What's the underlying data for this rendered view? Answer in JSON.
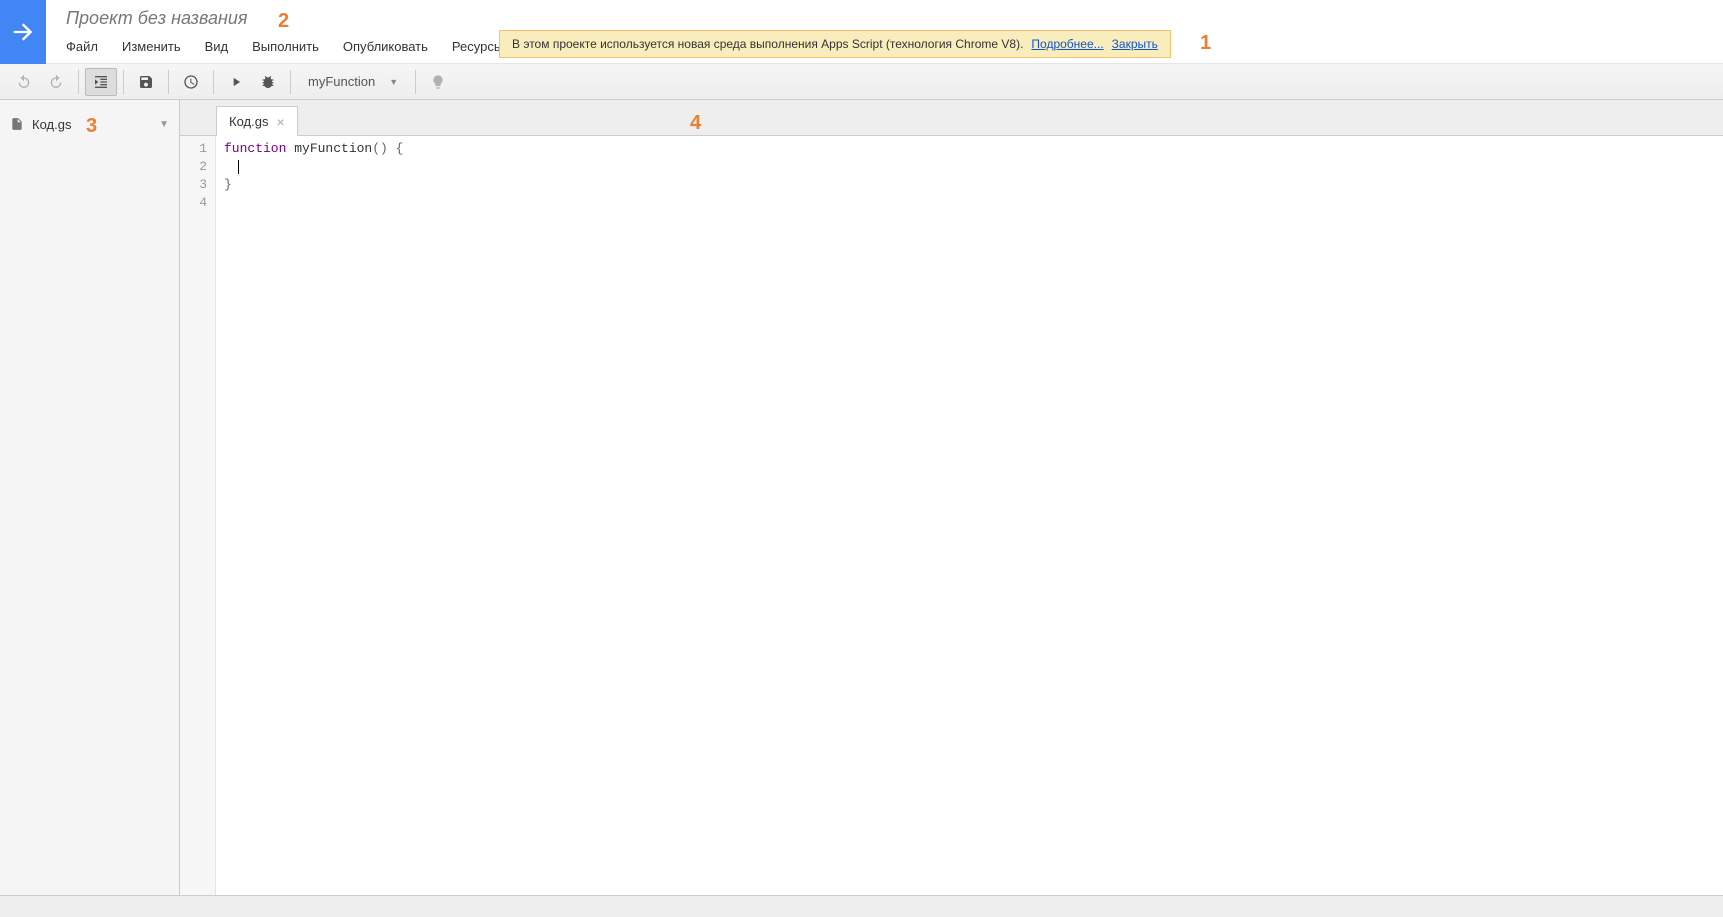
{
  "header": {
    "project_title": "Проект без названия",
    "menu": {
      "file": "Файл",
      "edit": "Изменить",
      "view": "Вид",
      "run": "Выполнить",
      "publish": "Опубликовать",
      "resources": "Ресурсы"
    }
  },
  "notification": {
    "text": "В этом проекте используется новая среда выполнения Apps Script (технология Chrome V8).",
    "more": "Подробнее...",
    "close": "Закрыть"
  },
  "toolbar": {
    "selected_function": "myFunction"
  },
  "sidebar": {
    "files": [
      {
        "name": "Код.gs"
      }
    ]
  },
  "tabs": {
    "active": "Код.gs"
  },
  "code": {
    "lines": [
      "1",
      "2",
      "3",
      "4"
    ],
    "tokens": {
      "l1_kw": "function",
      "l1_name": " myFunction",
      "l1_rest": "() {",
      "l2": "  ",
      "l3": "}",
      "l4": ""
    }
  },
  "annotations": {
    "a1": "1",
    "a2": "2",
    "a3": "3",
    "a4": "4"
  }
}
